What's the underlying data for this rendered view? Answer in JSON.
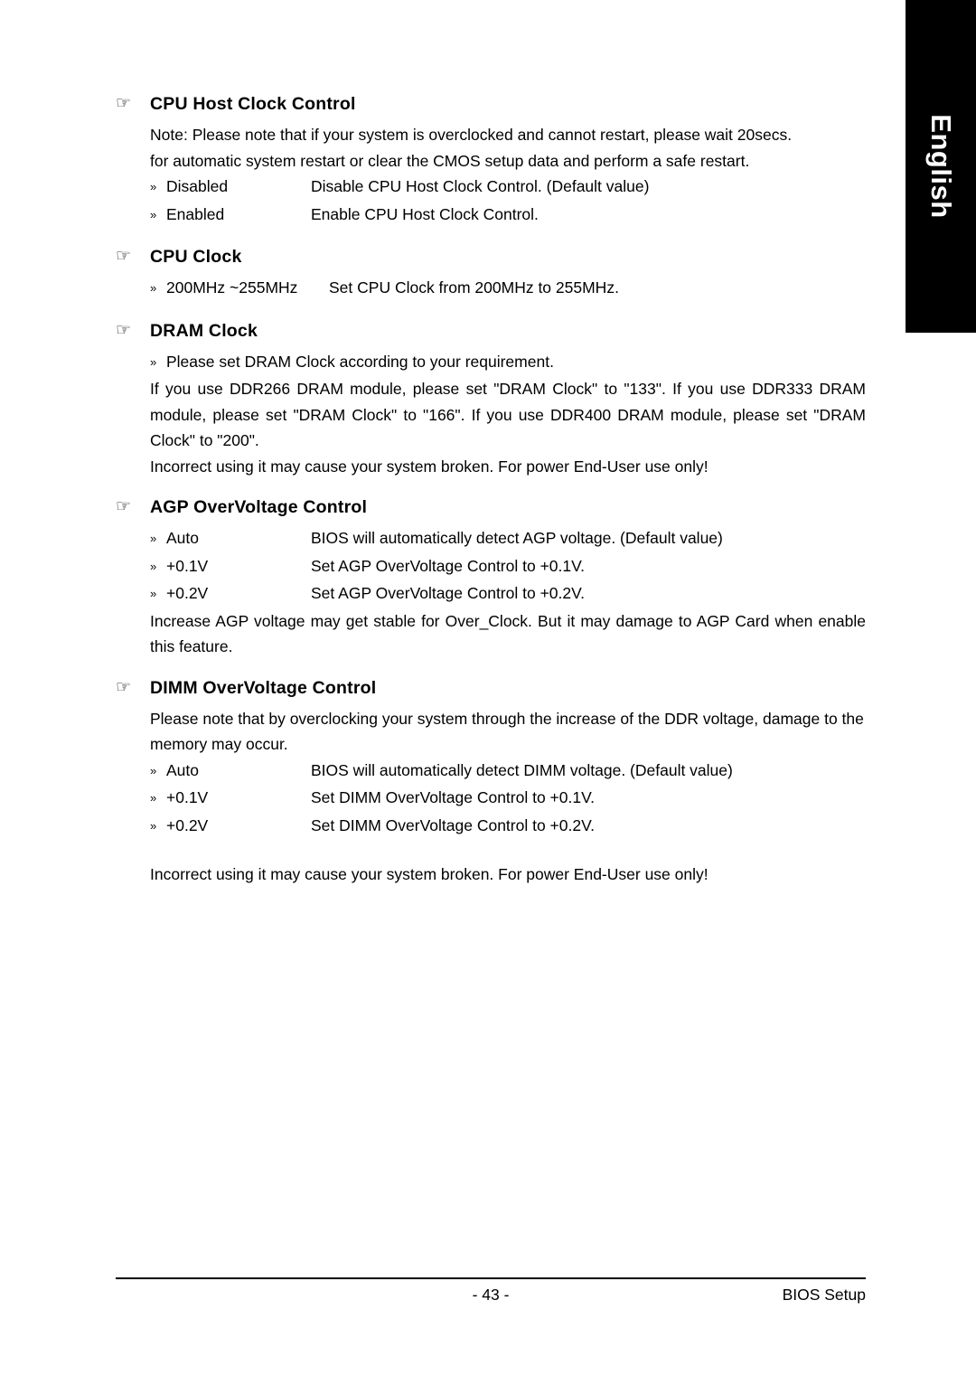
{
  "sidebar": {
    "tab_label": "English"
  },
  "sections": [
    {
      "icon": "pointing-hand-icon",
      "title": "CPU Host Clock Control",
      "notes": [
        "Note: Please note that if your system is overclocked and cannot restart, please wait 20secs.",
        "for automatic system restart or clear the CMOS setup data and perform a safe restart."
      ],
      "options": [
        {
          "bullet": "»",
          "name": "Disabled",
          "desc": "Disable CPU Host Clock Control. (Default value)"
        },
        {
          "bullet": "»",
          "name": "Enabled",
          "desc": "Enable CPU Host  Clock Control."
        }
      ],
      "after": []
    },
    {
      "icon": "pointing-hand-icon",
      "title": "CPU Clock",
      "notes": [],
      "options": [
        {
          "bullet": "»",
          "name": "200MHz ~255MHz",
          "desc": "Set CPU Clock from 200MHz to 255MHz."
        }
      ],
      "after": []
    },
    {
      "icon": "pointing-hand-icon",
      "title": "DRAM Clock",
      "notes": [],
      "options": [
        {
          "bullet": "»",
          "name": "Please set DRAM Clock according to your requirement.",
          "desc": ""
        }
      ],
      "after": [
        "If you use DDR266 DRAM module, please set \"DRAM Clock\" to \"133\". If you use DDR333 DRAM module, please set \"DRAM Clock\" to \"166\". If you use DDR400 DRAM module, please set \"DRAM Clock\" to \"200\".",
        "Incorrect using it may cause your system broken. For power End-User use only!"
      ]
    },
    {
      "icon": "pointing-hand-icon",
      "title": "AGP OverVoltage Control",
      "notes": [],
      "options": [
        {
          "bullet": "»",
          "name": "Auto",
          "desc": "BIOS will automatically detect AGP voltage. (Default value)"
        },
        {
          "bullet": "»",
          "name": "+0.1V",
          "desc": "Set AGP OverVoltage Control to +0.1V."
        },
        {
          "bullet": "»",
          "name": "+0.2V",
          "desc": "Set AGP OverVoltage Control to +0.2V."
        }
      ],
      "after": [
        "Increase AGP voltage may get stable for Over_Clock. But it may damage to AGP Card when enable this feature."
      ]
    },
    {
      "icon": "pointing-hand-icon",
      "title": "DIMM OverVoltage Control",
      "notes": [
        "Please note that by overclocking your system through the increase of the DDR voltage, damage to the",
        "memory may occur."
      ],
      "options": [
        {
          "bullet": "»",
          "name": "Auto",
          "desc": "BIOS will automatically detect DIMM voltage. (Default value)"
        },
        {
          "bullet": "»",
          "name": "+0.1V",
          "desc": "Set DIMM OverVoltage Control to +0.1V."
        },
        {
          "bullet": "»",
          "name": "+0.2V",
          "desc": "Set DIMM OverVoltage Control to +0.2V."
        }
      ],
      "after": [
        "Incorrect using it may cause your system broken. For power End-User use only!"
      ]
    }
  ],
  "footer": {
    "page_number": "- 43 -",
    "doc_title": "BIOS Setup"
  },
  "icons": {
    "pointing_hand": "☞"
  }
}
